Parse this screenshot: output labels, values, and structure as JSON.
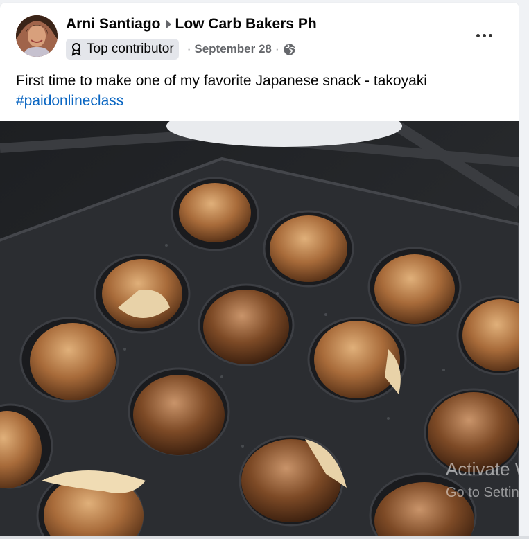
{
  "post": {
    "author": "Arni Santiago",
    "group": "Low Carb Bakers Ph",
    "badge": "Top contributor",
    "date": "September 28",
    "separator": "·",
    "text": "First time to make one of my favorite Japanese snack - takoyaki",
    "hashtag": "#paidonlineclass"
  },
  "overlay": {
    "line1": "Activate W",
    "line2": "Go to Setting"
  },
  "colors": {
    "link": "#0a66c2",
    "secondary_text": "#65676b",
    "badge_bg": "#e4e6eb",
    "pan": "#26282b",
    "takoyaki": "#b07a45"
  },
  "icons": [
    "avatar",
    "triangle-right-icon",
    "badge-icon",
    "globe-icon",
    "more-options-icon"
  ]
}
